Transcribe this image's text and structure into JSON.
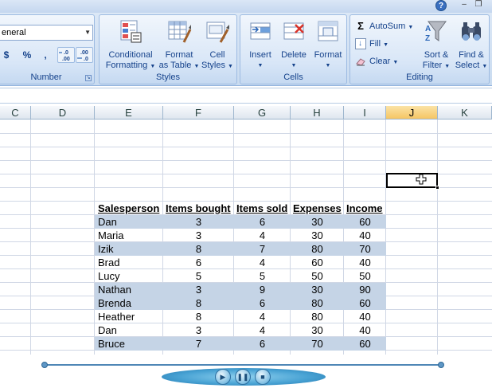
{
  "ribbon": {
    "number_format": "eneral",
    "number_group_label": "Number",
    "number_buttons": [
      "$",
      "%",
      ",",
      ".00 →.0",
      "→.00 .0"
    ],
    "styles_group_label": "Styles",
    "styles_buttons": [
      {
        "line1": "Conditional",
        "line2": "Formatting"
      },
      {
        "line1": "Format",
        "line2": "as Table"
      },
      {
        "line1": "Cell",
        "line2": "Styles"
      }
    ],
    "cells_group_label": "Cells",
    "cells_buttons": [
      "Insert",
      "Delete",
      "Format"
    ],
    "editing_group_label": "Editing",
    "autosum": "AutoSum",
    "fill": "Fill",
    "clear": "Clear",
    "sort": {
      "line1": "Sort &",
      "line2": "Filter"
    },
    "find": {
      "line1": "Find &",
      "line2": "Select"
    },
    "help_glyph": "?"
  },
  "grid": {
    "columns": [
      {
        "label": "C",
        "selected": false
      },
      {
        "label": "D",
        "selected": false
      },
      {
        "label": "E",
        "selected": false
      },
      {
        "label": "F",
        "selected": false
      },
      {
        "label": "G",
        "selected": false
      },
      {
        "label": "H",
        "selected": false
      },
      {
        "label": "I",
        "selected": false
      },
      {
        "label": "J",
        "selected": true
      },
      {
        "label": "K",
        "selected": false
      }
    ]
  },
  "table": {
    "headers": [
      "Salesperson",
      "Items bought",
      "Items sold",
      "Expenses",
      "Income"
    ],
    "rows": [
      {
        "name": "Dan",
        "bought": "3",
        "sold": "6",
        "expenses": "30",
        "income": "60",
        "shaded": true
      },
      {
        "name": "Maria",
        "bought": "3",
        "sold": "4",
        "expenses": "30",
        "income": "40",
        "shaded": false
      },
      {
        "name": "Izik",
        "bought": "8",
        "sold": "7",
        "expenses": "80",
        "income": "70",
        "shaded": true
      },
      {
        "name": "Brad",
        "bought": "6",
        "sold": "4",
        "expenses": "60",
        "income": "40",
        "shaded": false
      },
      {
        "name": "Lucy",
        "bought": "5",
        "sold": "5",
        "expenses": "50",
        "income": "50",
        "shaded": false
      },
      {
        "name": "Nathan",
        "bought": "3",
        "sold": "9",
        "expenses": "30",
        "income": "90",
        "shaded": true
      },
      {
        "name": "Brenda",
        "bought": "8",
        "sold": "6",
        "expenses": "80",
        "income": "60",
        "shaded": true
      },
      {
        "name": "Heather",
        "bought": "8",
        "sold": "4",
        "expenses": "80",
        "income": "40",
        "shaded": false
      },
      {
        "name": "Dan",
        "bought": "3",
        "sold": "4",
        "expenses": "30",
        "income": "40",
        "shaded": false
      },
      {
        "name": "Bruce",
        "bought": "7",
        "sold": "6",
        "expenses": "70",
        "income": "60",
        "shaded": true
      }
    ]
  },
  "colors": {
    "row_shade": "#c5d4e6",
    "selected_column": "#f5c564",
    "ribbon_text": "#15428b"
  }
}
